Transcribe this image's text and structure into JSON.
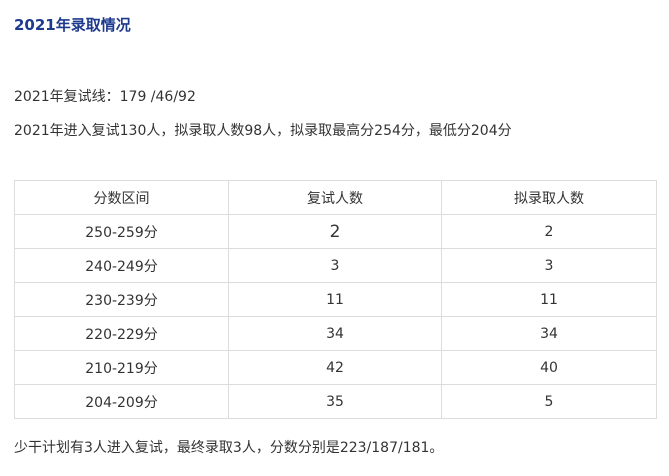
{
  "title": "2021年录取情况",
  "line1": "2021年复试线：179 /46/92",
  "line2": "2021年进入复试130人，拟录取人数98人，拟录取最高分254分，最低分204分",
  "table": {
    "headers": [
      "分数区间",
      "复试人数",
      "拟录取人数"
    ],
    "rows": [
      [
        "250-259分",
        "2",
        "2"
      ],
      [
        "240-249分",
        "3",
        "3"
      ],
      [
        "230-239分",
        "11",
        "11"
      ],
      [
        "220-229分",
        "34",
        "34"
      ],
      [
        "210-219分",
        "42",
        "40"
      ],
      [
        "204-209分",
        "35",
        "5"
      ]
    ]
  },
  "footer": "少干计划有3人进入复试，最终录取3人，分数分别是223/187/181。"
}
